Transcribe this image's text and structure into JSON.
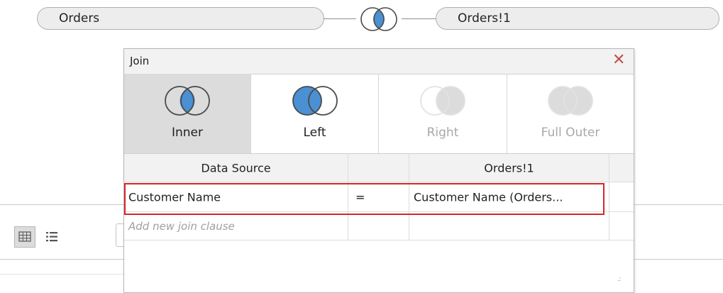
{
  "join_bar": {
    "left_table": "Orders",
    "right_table": "Orders!1",
    "join_icon": "inner-join-venn-icon"
  },
  "dialog": {
    "title": "Join",
    "close_icon": "close-icon",
    "join_types": [
      {
        "label": "Inner",
        "icon": "inner-join-venn-icon",
        "selected": true,
        "enabled": true
      },
      {
        "label": "Left",
        "icon": "left-join-venn-icon",
        "selected": false,
        "enabled": true
      },
      {
        "label": "Right",
        "icon": "right-join-venn-icon",
        "selected": false,
        "enabled": false
      },
      {
        "label": "Full Outer",
        "icon": "full-outer-join-venn-icon",
        "selected": false,
        "enabled": false
      }
    ],
    "clause_table": {
      "headers": [
        "Data Source",
        "",
        "Orders!1"
      ],
      "rows": [
        {
          "left": "Customer Name",
          "operator": "=",
          "right": "Customer Name (Orders..."
        }
      ],
      "add_placeholder": "Add new join clause"
    }
  },
  "toolbar": {
    "grid_view_icon": "grid-view-icon",
    "list_view_icon": "list-view-icon"
  },
  "colors": {
    "venn_fill": "#4a90d2",
    "close": "#c0504d",
    "highlight_border": "#d3272b",
    "selected_tab_bg": "#dcdcdc"
  }
}
